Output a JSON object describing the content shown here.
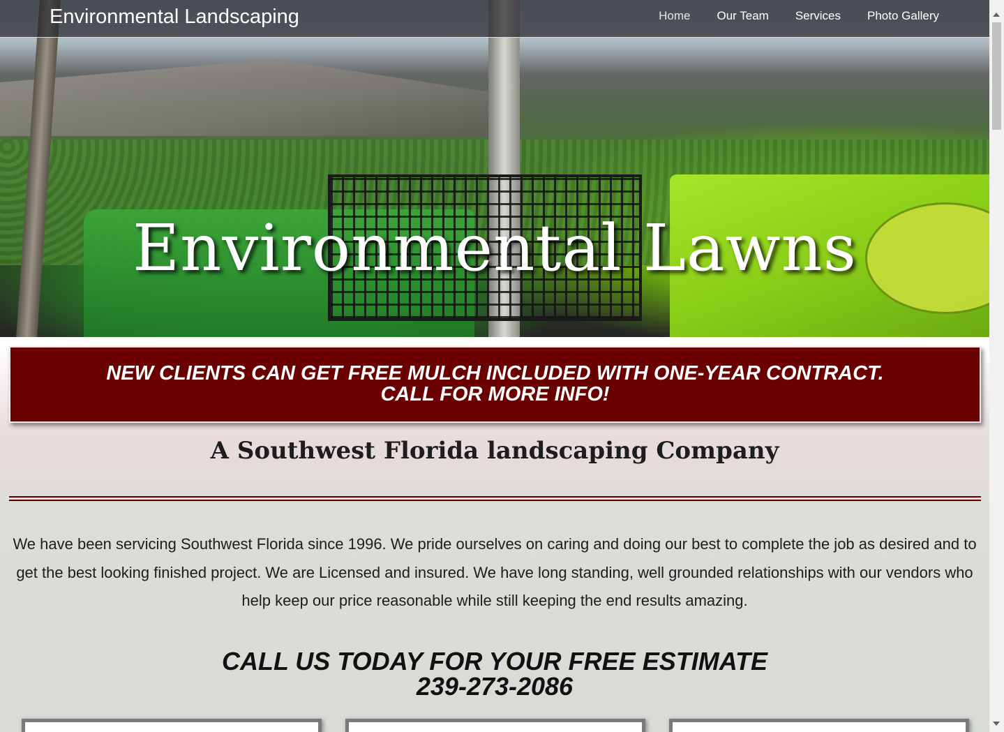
{
  "navbar": {
    "brand": "Environmental Landscaping",
    "links": [
      "Home",
      "Our Team",
      "Services",
      "Photo Gallery"
    ]
  },
  "hero": {
    "title": "Environmental Lawns"
  },
  "promo": {
    "line1": "NEW CLIENTS CAN GET FREE MULCH INCLUDED WITH ONE-YEAR CONTRACT.",
    "line2": "CALL FOR MORE INFO!"
  },
  "tagline": "A Southwest Florida landscaping Company",
  "about": "We have been servicing Southwest Florida since 1996. We pride ourselves on caring and doing our best to complete the job as desired and to get the best looking finished project. We are Licensed and insured. We have long standing, well grounded relationships with our vendors who help keep our price reasonable while still keeping the end results amazing.",
  "cta": {
    "line1": "CALL US TODAY FOR YOUR FREE ESTIMATE",
    "phone": "239-273-2086"
  },
  "colors": {
    "promo_bg": "#6b0000",
    "divider": "#5a0000",
    "navbar_bg": "#28282c"
  }
}
